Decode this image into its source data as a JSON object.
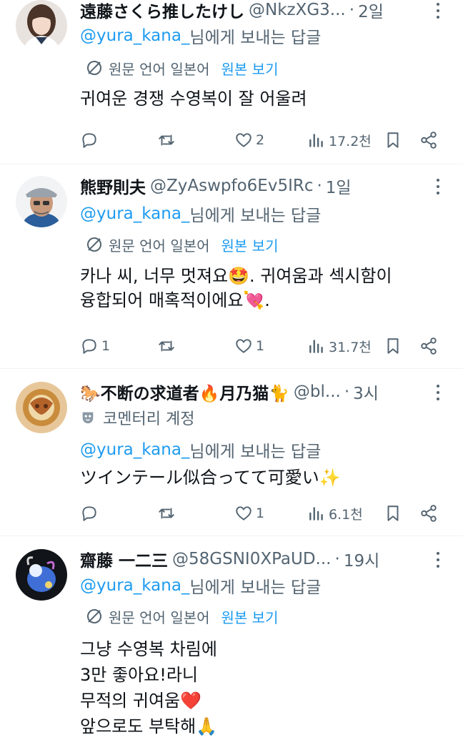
{
  "tweets": [
    {
      "name": "遠藤さくら推したけし",
      "handle": "@NkzXG3...",
      "dot": "·",
      "time": "2일",
      "reply_prefix": "@yura_kana_",
      "reply_suffix": " 님에게 보내는 답글",
      "translate_label": "원문 언어 일본어",
      "show_original": "원본 보기",
      "body": [
        "귀여운 경쟁 수영복이 잘 어울려"
      ],
      "replies": "",
      "retweets": "",
      "likes": "2",
      "views": "17.2천"
    },
    {
      "name": "熊野則夫",
      "handle": "@ZyAswpfo6Ev5IRc",
      "dot": "·",
      "time": "1일",
      "reply_prefix": "@yura_kana_",
      "reply_suffix": " 님에게 보내는 답글",
      "translate_label": "원문 언어 일본어",
      "show_original": "원본 보기",
      "body": [
        "카나 씨, 너무 멋져요🤩. 귀여움과 섹시함이",
        "융합되어 매혹적이에요💘."
      ],
      "replies": "1",
      "retweets": "",
      "likes": "1",
      "views": "31.7천"
    },
    {
      "name": "🐎不断の求道者🔥月乃猫🐈",
      "handle": "@bl...",
      "dot": "·",
      "time": "3시",
      "community_label": "코멘터리 계정",
      "reply_prefix": "@yura_kana_",
      "reply_suffix": " 님에게 보내는 답글",
      "body": [
        "ツインテール似合ってて可愛い✨"
      ],
      "replies": "",
      "retweets": "",
      "likes": "1",
      "views": "6.1천"
    },
    {
      "name": "齋藤 一二三",
      "handle": "@58GSNI0XPaUD...",
      "dot": "·",
      "time": "19시",
      "reply_prefix": "@yura_kana_",
      "reply_suffix": " 님에게 보내는 답글",
      "translate_label": "원문 언어 일본어",
      "show_original": "원본 보기",
      "body": [
        "그냥 수영복 차림에",
        "3만 좋아요!라니",
        "무적의 귀여움❤️",
        "앞으로도 부탁해🙏"
      ]
    }
  ],
  "icons": {
    "reply": "reply-icon",
    "retweet": "retweet-icon",
    "like": "heart-icon",
    "views": "views-icon",
    "bookmark": "bookmark-icon",
    "share": "share-icon",
    "more": "more-icon",
    "translate": "translate-icon",
    "community": "mask-icon"
  },
  "colors": {
    "accent": "#1d9bf0",
    "secondary": "#536471",
    "text": "#0f1419",
    "divider": "#eff3f4"
  }
}
